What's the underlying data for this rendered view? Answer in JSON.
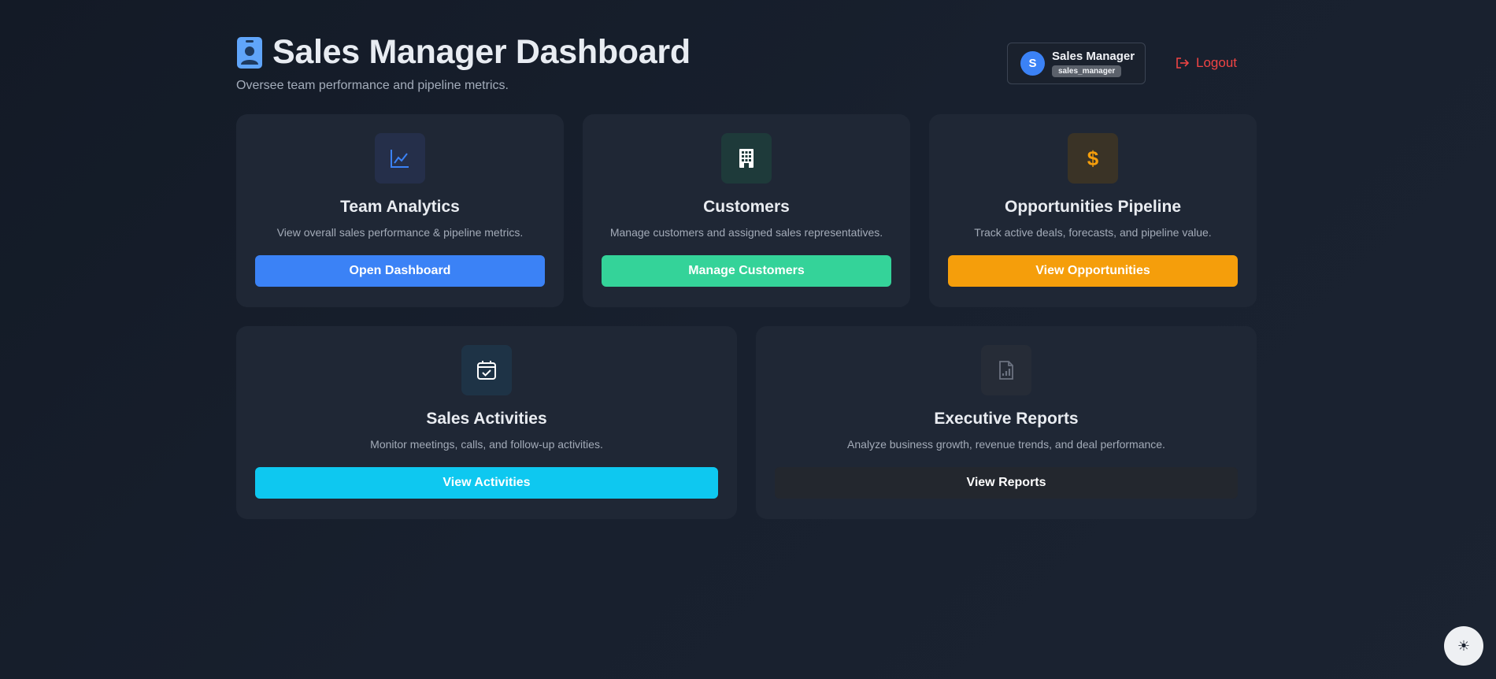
{
  "header": {
    "title": "Sales Manager Dashboard",
    "subtitle": "Oversee team performance and pipeline metrics."
  },
  "user": {
    "initial": "S",
    "name": "Sales Manager",
    "role": "sales_manager"
  },
  "logout_label": "Logout",
  "cards": [
    {
      "icon": "line-chart-icon",
      "title": "Team Analytics",
      "description": "View overall sales performance & pipeline metrics.",
      "button": "Open Dashboard",
      "accent": "#3b82f6"
    },
    {
      "icon": "building-icon",
      "title": "Customers",
      "description": "Manage customers and assigned sales representatives.",
      "button": "Manage Customers",
      "accent": "#34d399"
    },
    {
      "icon": "dollar-icon",
      "title": "Opportunities Pipeline",
      "description": "Track active deals, forecasts, and pipeline value.",
      "button": "View Opportunities",
      "accent": "#f59e0b"
    },
    {
      "icon": "calendar-check-icon",
      "title": "Sales Activities",
      "description": "Monitor meetings, calls, and follow-up activities.",
      "button": "View Activities",
      "accent": "#0ec8f0"
    },
    {
      "icon": "report-file-icon",
      "title": "Executive Reports",
      "description": "Analyze business growth, revenue trends, and deal performance.",
      "button": "View Reports",
      "accent": "#23272e"
    }
  ],
  "theme_toggle_icon": "sun-icon",
  "theme_toggle_glyph": "☀"
}
